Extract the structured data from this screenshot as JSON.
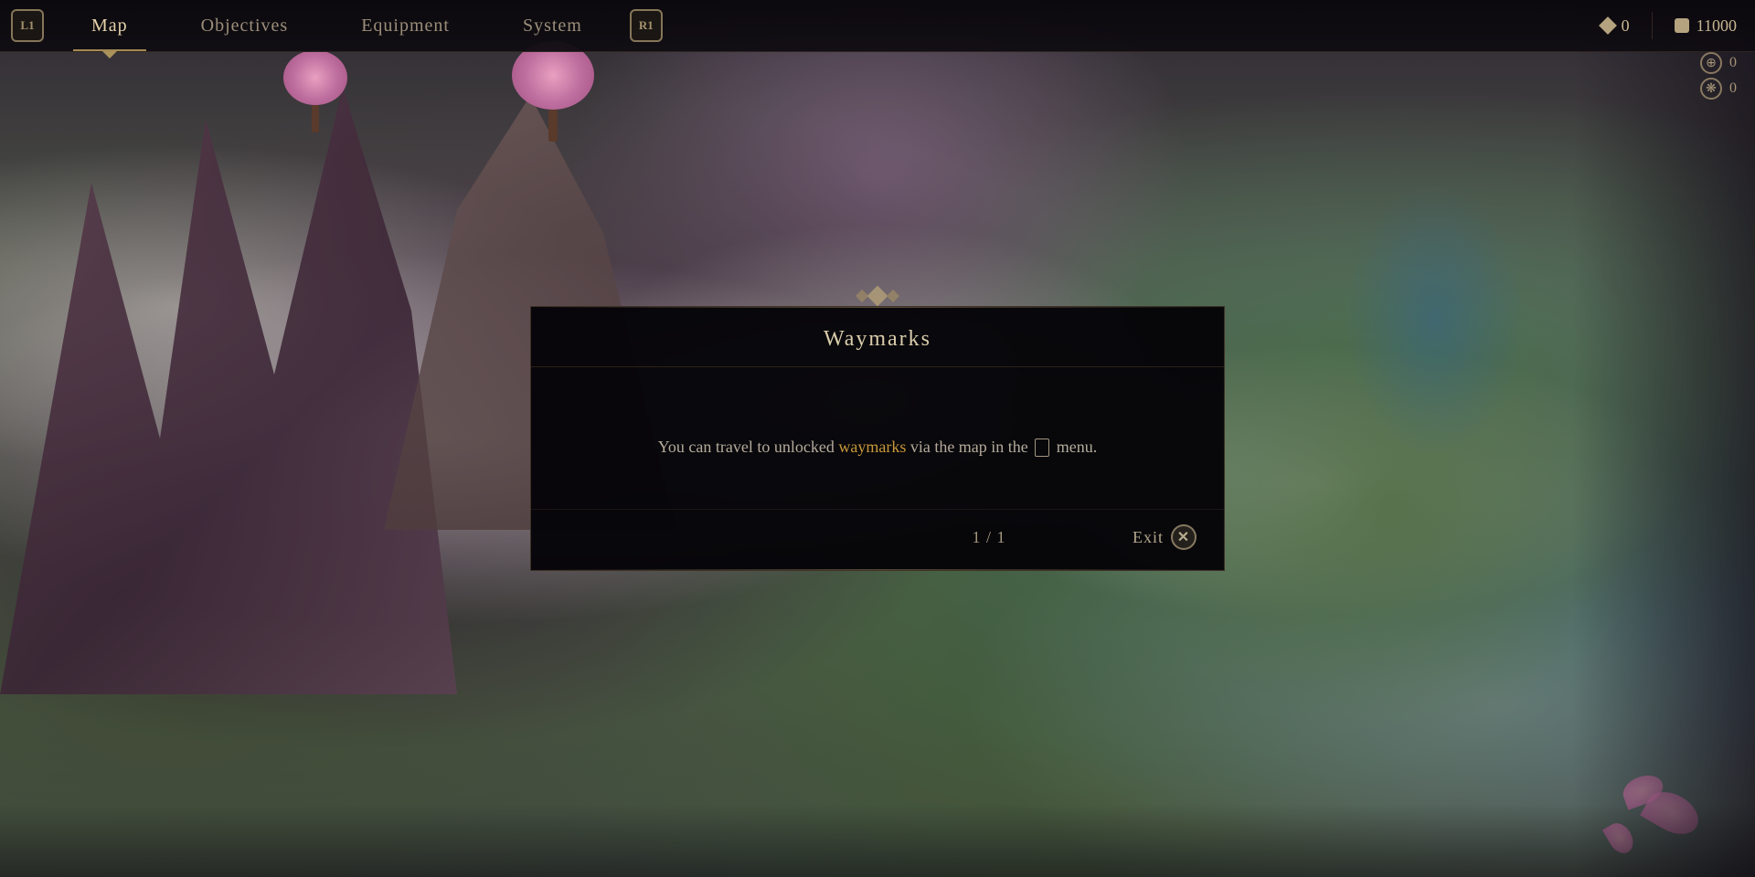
{
  "nav": {
    "left_badge": "L1",
    "right_badge": "R1",
    "tabs": [
      {
        "id": "map",
        "label": "Map",
        "active": true
      },
      {
        "id": "objectives",
        "label": "Objectives",
        "active": false
      },
      {
        "id": "equipment",
        "label": "Equipment",
        "active": false
      },
      {
        "id": "system",
        "label": "System",
        "active": false
      }
    ],
    "currency_diamond_value": "0",
    "currency_stop_value": "11000",
    "globe_value": "0",
    "crystal_value": "0"
  },
  "dialog": {
    "ornament_label": "◆",
    "title": "Waymarks",
    "body_pre": "You can travel to unlocked ",
    "body_highlight": "waymarks",
    "body_post": " via the map in the",
    "body_menu": "🗒",
    "body_end": "menu.",
    "page_current": "1",
    "page_total": "1",
    "page_separator": "/",
    "exit_label": "Exit"
  }
}
